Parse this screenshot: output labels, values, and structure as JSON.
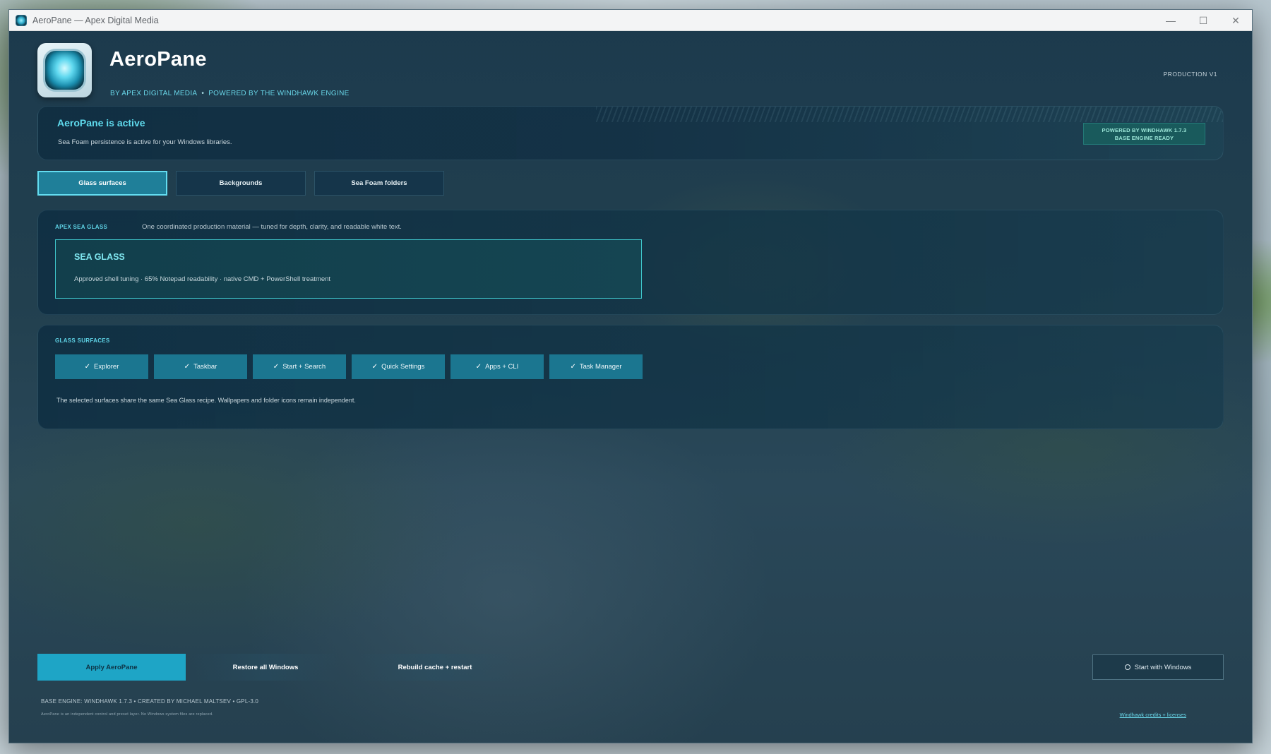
{
  "window": {
    "title": "AeroPane — Apex Digital Media",
    "controls": {
      "minimize": "—",
      "maximize": "☐",
      "close": "✕"
    }
  },
  "header": {
    "app_name": "AeroPane",
    "byline": "BY APEX DIGITAL MEDIA",
    "engine_line": "POWERED BY THE WINDHAWK ENGINE",
    "separator": "•",
    "production_badge": "PRODUCTION V1"
  },
  "status": {
    "title": "AeroPane is active",
    "description": "Sea Foam persistence is active for your Windows libraries.",
    "engine_badge_line1": "POWERED BY WINDHAWK 1.7.3",
    "engine_badge_line2": "BASE ENGINE READY"
  },
  "tabs": [
    {
      "label": "Glass surfaces",
      "active": true
    },
    {
      "label": "Backgrounds",
      "active": false
    },
    {
      "label": "Sea Foam folders",
      "active": false
    }
  ],
  "material": {
    "section_label": "APEX SEA GLASS",
    "section_sub": "One coordinated production material — tuned for depth, clarity, and readable white text.",
    "card_title": "SEA GLASS",
    "card_desc": "Approved shell tuning · 65% Notepad readability · native CMD + PowerShell treatment"
  },
  "surfaces": {
    "section_label": "GLASS SURFACES",
    "check_glyph": "✓",
    "items": [
      {
        "label": "Explorer",
        "checked": true
      },
      {
        "label": "Taskbar",
        "checked": true
      },
      {
        "label": "Start + Search",
        "checked": true
      },
      {
        "label": "Quick Settings",
        "checked": true
      },
      {
        "label": "Apps + CLI",
        "checked": true
      },
      {
        "label": "Task Manager",
        "checked": true
      }
    ],
    "note": "The selected surfaces share the same Sea Glass recipe. Wallpapers and folder icons remain independent."
  },
  "actions": {
    "apply": "Apply AeroPane",
    "restore": "Restore all Windows",
    "rebuild": "Rebuild cache + restart",
    "start_with_windows": "Start with Windows",
    "start_with_windows_checked": false
  },
  "footer": {
    "credits": "BASE ENGINE: WINDHAWK 1.7.3 • CREATED BY MICHAEL MALTSEV • GPL-3.0",
    "tiny_note": "AeroPane is an independent control and preset layer. No Windows system files are replaced.",
    "licenses_link": "Windhawk credits + licenses"
  },
  "colors": {
    "accent": "#1ea5c6",
    "accent_text": "#5fdbee",
    "chip_bg": "#1b7690",
    "engine_badge_bg": "#195a5c"
  }
}
